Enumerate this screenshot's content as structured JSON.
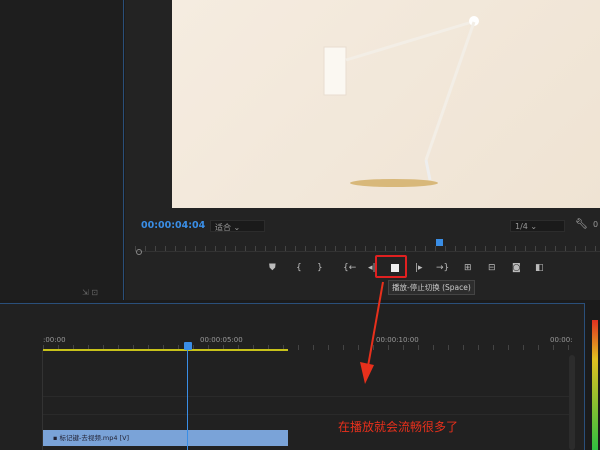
{
  "monitor": {
    "timecode": "00:00:04:04",
    "fit": "适合",
    "resolution": "1/4",
    "wrench_value": "0"
  },
  "controls": [
    "add-marker",
    "mark-in",
    "mark-out",
    "go-to-in",
    "step-back",
    "play-stop",
    "step-forward",
    "go-to-out",
    "insert",
    "overwrite",
    "export-frame",
    "compare"
  ],
  "tooltip": "播放-停止切换 (Space)",
  "timeline": {
    "ticks": [
      ":00:00",
      "00:00:05:00",
      "00:00:10:00",
      "00:00:"
    ],
    "clip": "标记键-去视频.mp4 [V]"
  },
  "annotation": "在播放就会流畅很多了",
  "colors": {
    "accent": "#3a8ee6",
    "highlight": "#e02020"
  }
}
